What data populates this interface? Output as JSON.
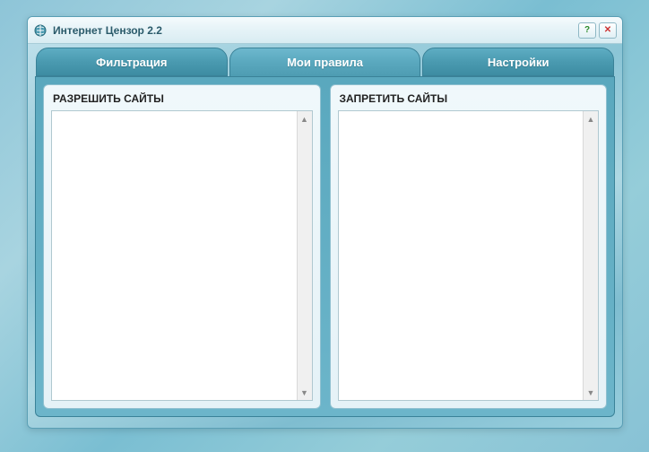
{
  "window": {
    "title": "Интернет Цензор 2.2"
  },
  "tabs": {
    "filtering": "Фильтрация",
    "myrules": "Мои правила",
    "settings": "Настройки"
  },
  "panels": {
    "allow_title": "РАЗРЕШИТЬ САЙТЫ",
    "deny_title": "ЗАПРЕТИТЬ САЙТЫ"
  }
}
